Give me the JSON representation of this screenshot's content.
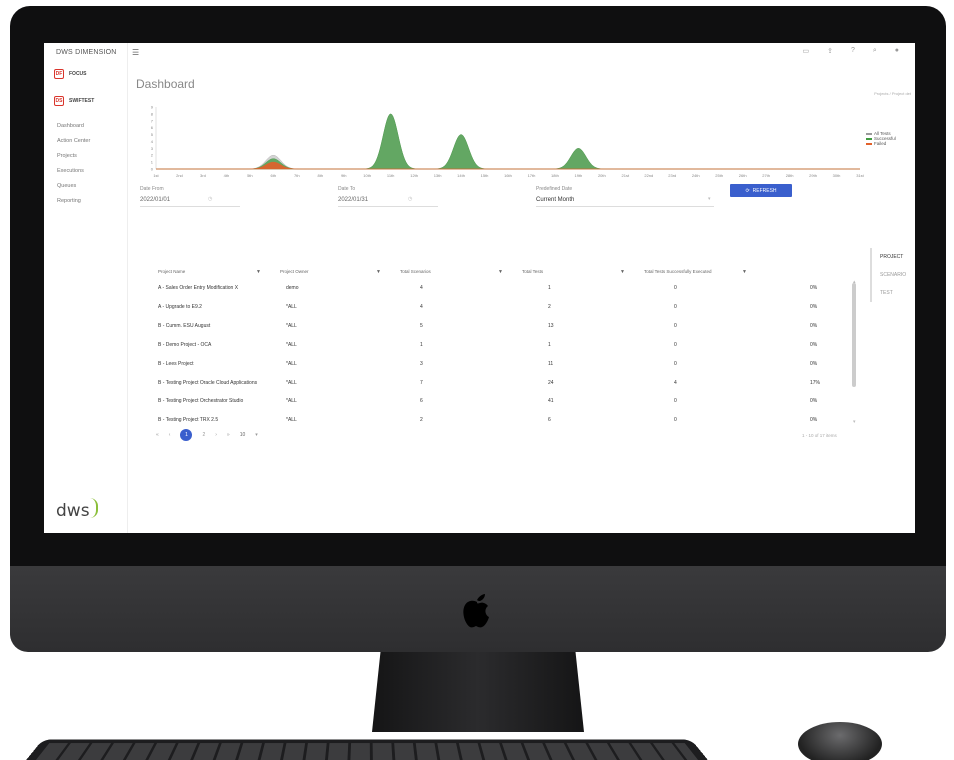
{
  "app": {
    "name": "DWS DIMENSION",
    "menu_icon": "☰",
    "top_icons": [
      "monitor-icon",
      "upload-icon",
      "help-icon",
      "search-icon",
      "user-icon"
    ],
    "logo_text": "dws"
  },
  "projects": [
    {
      "badge": "DF",
      "label": "FOCUS"
    },
    {
      "badge": "DS",
      "label": "SWIFTEST"
    }
  ],
  "nav": [
    "Dashboard",
    "Action Center",
    "Projects",
    "Executions",
    "Queues",
    "Reporting"
  ],
  "page": {
    "title": "Dashboard",
    "breadcrumb": "Projects / Project det"
  },
  "legend": [
    {
      "label": "All Tests",
      "color": "#9a9a9a"
    },
    {
      "label": "Successful",
      "color": "#3f9a3f"
    },
    {
      "label": "Failed",
      "color": "#e2612a"
    }
  ],
  "chart_data": {
    "type": "area",
    "x": [
      "1st",
      "2nd",
      "3rd",
      "4th",
      "5th",
      "6th",
      "7th",
      "8th",
      "9th",
      "10th",
      "11th",
      "12th",
      "13th",
      "14th",
      "15th",
      "16th",
      "17th",
      "18th",
      "19th",
      "20th",
      "21st",
      "22nd",
      "23rd",
      "24th",
      "25th",
      "26th",
      "27th",
      "28th",
      "29th",
      "30th",
      "31st"
    ],
    "series": [
      {
        "name": "All Tests",
        "values": [
          0,
          0,
          0,
          0,
          0,
          2,
          0,
          0,
          0,
          0,
          8,
          0,
          0,
          5,
          0,
          0,
          0,
          0,
          3,
          0,
          0,
          0,
          0,
          0,
          0,
          0,
          0,
          0,
          0,
          0,
          0
        ]
      },
      {
        "name": "Successful",
        "values": [
          0,
          0,
          0,
          0,
          0,
          1.5,
          0,
          0,
          0,
          0,
          8,
          0,
          0,
          5,
          0,
          0,
          0,
          0,
          3,
          0,
          0,
          0,
          0,
          0,
          0,
          0,
          0,
          0,
          0,
          0,
          0
        ]
      },
      {
        "name": "Failed",
        "values": [
          0,
          0,
          0,
          0,
          0,
          1,
          0,
          0,
          0,
          0,
          0,
          0,
          0,
          0,
          0,
          0,
          0,
          0,
          0,
          0,
          0,
          0,
          0,
          0,
          0,
          0,
          0,
          0,
          0,
          0,
          0
        ]
      }
    ],
    "ylim": [
      0,
      9
    ],
    "yticks": [
      "0",
      "1",
      "2",
      "3",
      "4",
      "5",
      "6",
      "7",
      "8",
      "9"
    ]
  },
  "filters": {
    "date_from_label": "Date From",
    "date_from": "2022/01/01",
    "date_to_label": "Date To",
    "date_to": "2022/01/31",
    "predefined_label": "Predefined Date",
    "predefined": "Current Month",
    "refresh": "REFRESH"
  },
  "side_tabs": [
    "PROJECT",
    "SCENARIO",
    "TEST"
  ],
  "table": {
    "columns": [
      "Project Name",
      "Project Owner",
      "Total Scenarios",
      "Total Tests",
      "Total Tests Successfully Executed",
      ""
    ],
    "rows": [
      [
        "A - Sales Order Entry Modification X",
        "demo",
        "4",
        "1",
        "0",
        "0%"
      ],
      [
        "A - Upgrade to E9.2",
        "*ALL",
        "4",
        "2",
        "0",
        "0%"
      ],
      [
        "B - Cumm. ESU August",
        "*ALL",
        "5",
        "13",
        "0",
        "0%"
      ],
      [
        "B - Demo Project - OCA",
        "*ALL",
        "1",
        "1",
        "0",
        "0%"
      ],
      [
        "B - Lees Project",
        "*ALL",
        "3",
        "11",
        "0",
        "0%"
      ],
      [
        "B - Testing Project Oracle Cloud Applications",
        "*ALL",
        "7",
        "24",
        "4",
        "17%"
      ],
      [
        "B - Testing Project Orchestrator Studio",
        "*ALL",
        "6",
        "41",
        "0",
        "0%"
      ],
      [
        "B - Testing Project TRX 2.5",
        "*ALL",
        "2",
        "6",
        "0",
        "0%"
      ]
    ]
  },
  "pager": {
    "first": "«",
    "prev": "‹",
    "pages": [
      "1",
      "2"
    ],
    "next": "›",
    "last": "»",
    "page_size": "10",
    "total": "1 - 10 of 17 items"
  }
}
